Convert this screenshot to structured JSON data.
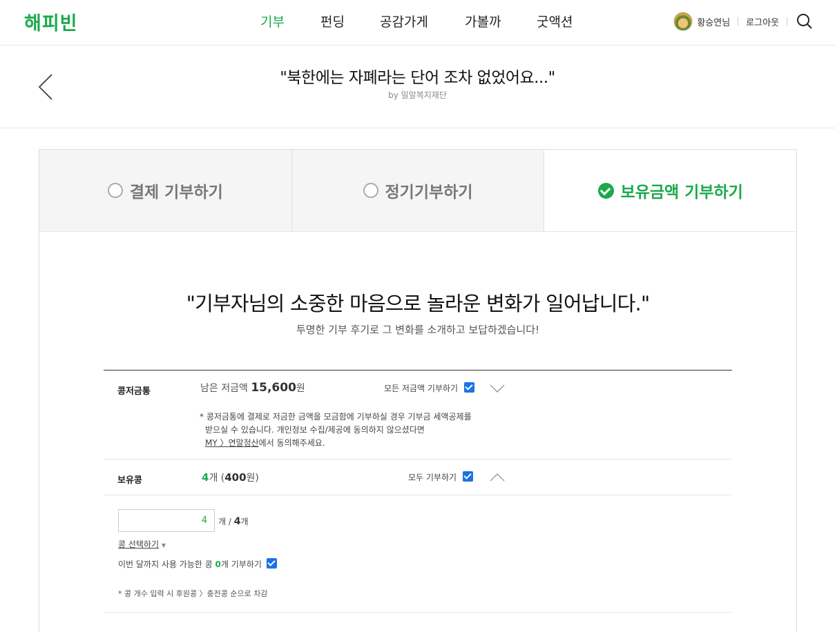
{
  "header": {
    "logo": "해피빈",
    "nav": [
      {
        "label": "기부",
        "active": true
      },
      {
        "label": "펀딩",
        "active": false
      },
      {
        "label": "공감가게",
        "active": false
      },
      {
        "label": "가볼까",
        "active": false
      },
      {
        "label": "굿액션",
        "active": false
      }
    ],
    "user_name": "황승연님",
    "logout": "로그아웃"
  },
  "titlebar": {
    "title": "\"북한에는 자폐라는 단어 조차 없었어요...\"",
    "by": "by 밀알복지재단"
  },
  "tabs": [
    {
      "label": "결제 기부하기",
      "selected": false
    },
    {
      "label": "정기기부하기",
      "selected": false
    },
    {
      "label": "보유금액 기부하기",
      "selected": true
    }
  ],
  "message": {
    "quote": "\"기부자님의 소중한 마음으로 놀라운 변화가 일어납니다.\"",
    "sub": "투명한 기부 후기로 그 변화를 소개하고 보답하겠습니다!"
  },
  "piggy": {
    "label": "콩저금통",
    "remain_prefix": "남은 저금액",
    "remain_amount": "15,600",
    "remain_unit": "원",
    "donate_all": "모든 저금액 기부하기",
    "note_line1": "* 콩저금통에 결제로 저금한 금액을 모금함에 기부하실 경우 기부금 세액공제를",
    "note_line2": "받으실 수 있습니다. 개인정보 수집/제공에 동의하지 않으셨다면",
    "note_link": "MY 〉연말정산",
    "note_tail": "에서 동의해주세요."
  },
  "beans": {
    "label": "보유콩",
    "count": "4",
    "count_unit": "개 (",
    "won": "400",
    "won_unit": "원)",
    "donate_all": "모두 기부하기",
    "input_value": "4",
    "of_prefix": "개 /",
    "of_total": "4",
    "of_unit": "개",
    "select_link": "콩 선택하기",
    "monthly_prefix": "이번 달까지 사용 가능한 콩",
    "monthly_count": "0",
    "monthly_suffix": "개 기부하기",
    "footnote": "* 콩 개수 입력 시 후원콩 〉충전콩 순으로 차감"
  }
}
